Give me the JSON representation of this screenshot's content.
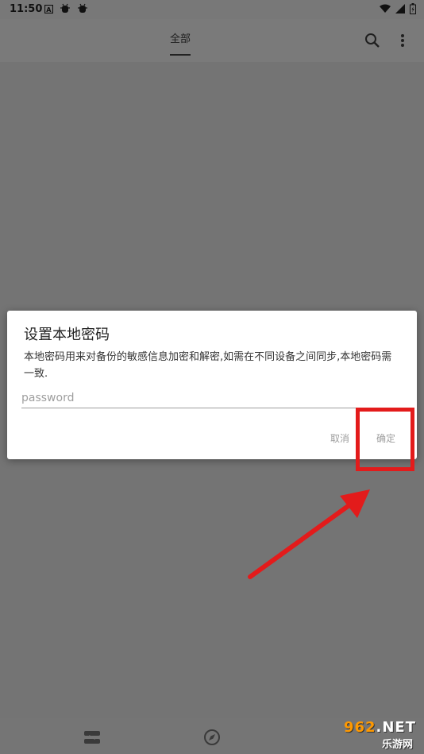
{
  "status_bar": {
    "time": "11:50",
    "left_icons": [
      "notification-a-icon",
      "bug-icon",
      "bug-icon"
    ],
    "right_icons": [
      "wifi-icon",
      "signal-icon",
      "battery-icon"
    ]
  },
  "app_bar": {
    "tab_label": "全部",
    "actions": [
      "search-icon",
      "more-vert-icon"
    ]
  },
  "dialog": {
    "title": "设置本地密码",
    "message": "本地密码用来对备份的敏感信息加密和解密,如需在不同设备之间同步,本地密码需一致.",
    "input_placeholder": "password",
    "input_value": "",
    "cancel_label": "取消",
    "confirm_label": "确定"
  },
  "annotation": {
    "highlight_color": "#e31b1b",
    "arrow_color": "#e31b1b"
  },
  "bottom_nav": {
    "items": [
      "stack-icon",
      "compass-icon"
    ]
  },
  "watermark": {
    "top_text_num": "962",
    "top_text_suffix": ".NET",
    "bottom_text": "乐游网"
  }
}
